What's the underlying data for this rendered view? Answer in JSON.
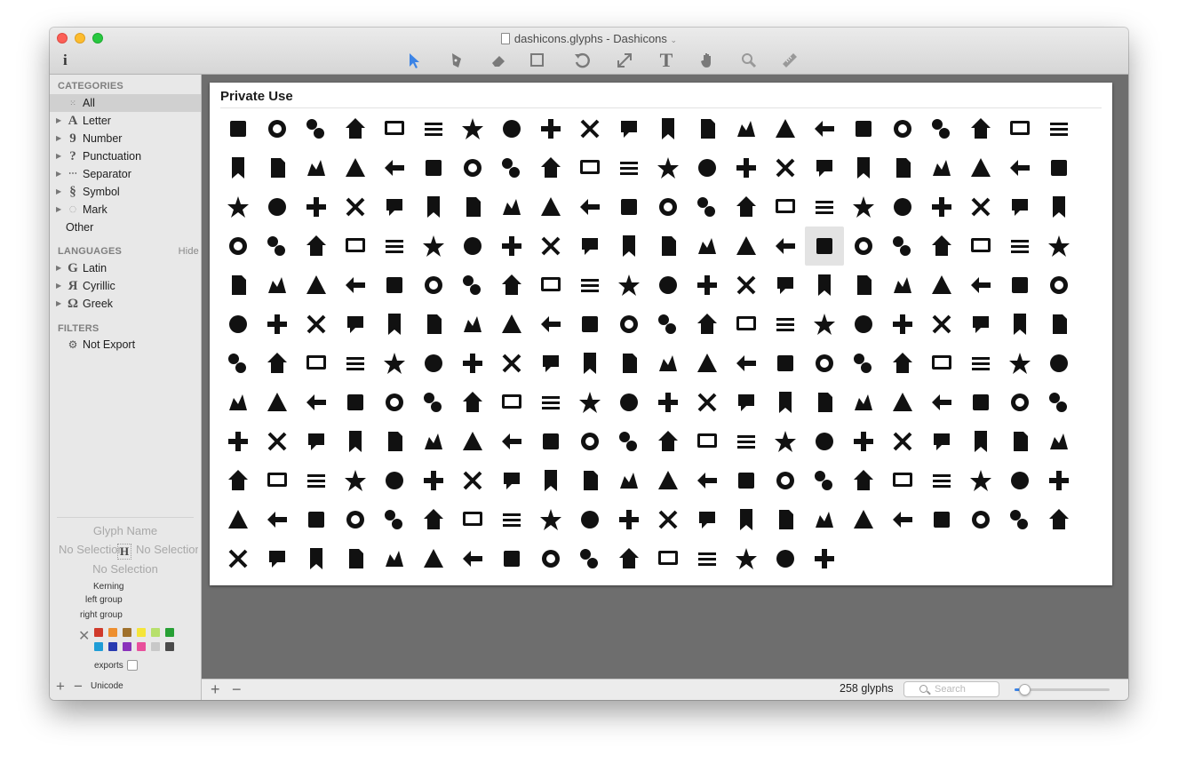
{
  "window": {
    "title": "dashicons.glyphs - Dashicons"
  },
  "toolbar": {
    "info_label": "i",
    "tools": [
      {
        "name": "select-tool",
        "icon": "arrow"
      },
      {
        "name": "pen-tool",
        "icon": "pen"
      },
      {
        "name": "eraser-tool",
        "icon": "eraser"
      },
      {
        "name": "primitives-tool",
        "icon": "square"
      },
      {
        "name": "rotate-tool",
        "icon": "rotate"
      },
      {
        "name": "scale-tool",
        "icon": "scale"
      },
      {
        "name": "text-tool",
        "icon": "T"
      },
      {
        "name": "hand-tool",
        "icon": "hand"
      },
      {
        "name": "zoom-tool",
        "icon": "magnifier"
      },
      {
        "name": "measure-tool",
        "icon": "ruler"
      }
    ]
  },
  "sidebar": {
    "categories_header": "CATEGORIES",
    "categories": [
      {
        "label": "All",
        "icon": "⁝⁝",
        "selected": true
      },
      {
        "label": "Letter",
        "icon": "A"
      },
      {
        "label": "Number",
        "icon": "9"
      },
      {
        "label": "Punctuation",
        "icon": "?"
      },
      {
        "label": "Separator",
        "icon": "_"
      },
      {
        "label": "Symbol",
        "icon": "§"
      },
      {
        "label": "Mark",
        "icon": "◌"
      },
      {
        "label": "Other",
        "icon": ""
      }
    ],
    "languages_header": "LANGUAGES",
    "languages_hide": "Hide",
    "languages": [
      {
        "label": "Latin",
        "icon": "G"
      },
      {
        "label": "Cyrillic",
        "icon": "Я"
      },
      {
        "label": "Greek",
        "icon": "Ω"
      }
    ],
    "filters_header": "FILTERS",
    "filters": [
      {
        "label": "Not Export",
        "icon": "⚙"
      }
    ]
  },
  "inspector": {
    "glyph_name": "Glyph Name",
    "left_sel": "No Selection",
    "right_sel": "No Selection",
    "width_sel": "No Selection",
    "kerning": "Kerning",
    "left_group": "left group",
    "right_group": "right group",
    "exports": "exports",
    "unicode": "Unicode",
    "colors": [
      "#d03a2b",
      "#ee8f2f",
      "#a0712c",
      "#f5e53a",
      "#b7e06c",
      "#27a035",
      "#1f9dd6",
      "#283bb1",
      "#8a32bb",
      "#e8509c",
      "#c8c8c8",
      "#4a4a4a"
    ]
  },
  "panel": {
    "title": "Private Use"
  },
  "glyph_count": 258,
  "status": {
    "count_label": "258 glyphs",
    "search_placeholder": "Search",
    "zoom": 0.1
  }
}
